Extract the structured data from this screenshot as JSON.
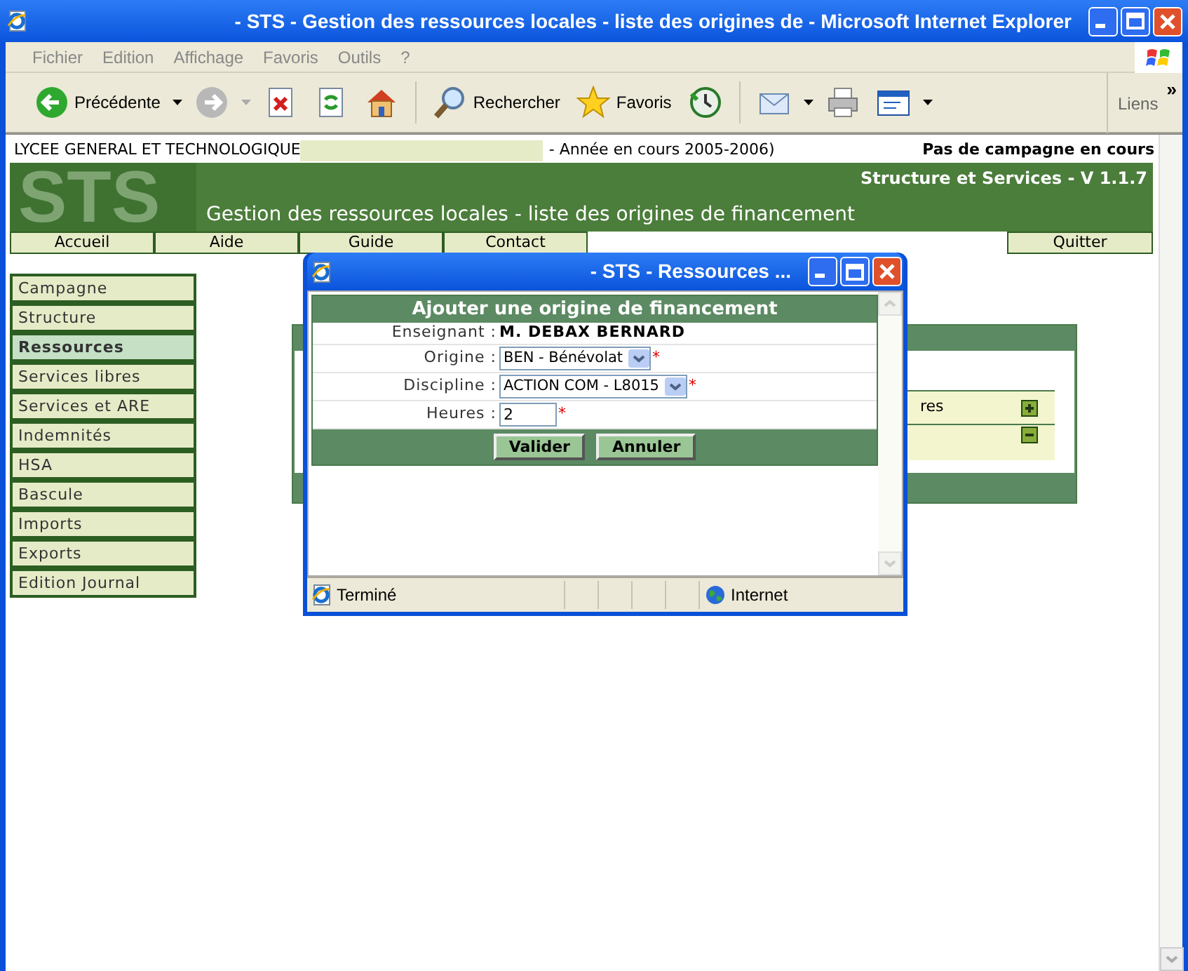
{
  "window": {
    "title": "- STS - Gestion des ressources locales - liste des origines de - Microsoft Internet Explorer"
  },
  "menu": [
    "Fichier",
    "Edition",
    "Affichage",
    "Favoris",
    "Outils",
    "?"
  ],
  "toolbar": [
    {
      "kind": "back",
      "label": "Précédente",
      "dropdown": true
    },
    {
      "kind": "forward",
      "dropdown": true
    },
    {
      "kind": "stop"
    },
    {
      "kind": "refresh"
    },
    {
      "kind": "home"
    },
    {
      "kind": "separator"
    },
    {
      "kind": "search",
      "label": "Rechercher"
    },
    {
      "kind": "favorites",
      "label": "Favoris"
    },
    {
      "kind": "history"
    },
    {
      "kind": "separator"
    },
    {
      "kind": "mail",
      "dropdown": true
    },
    {
      "kind": "print"
    },
    {
      "kind": "edit",
      "dropdown": true
    }
  ],
  "links": {
    "label": "Liens",
    "chevron": "»"
  },
  "page": {
    "school": "LYCEE GENERAL ET TECHNOLOGIQUE",
    "year": "- Année en cours 2005-2006)",
    "campaign": "Pas de campagne en cours",
    "logo": "STS",
    "version": "Structure et Services - V 1.1.7",
    "heading": "Gestion des ressources locales - liste des origines de financement",
    "nav": [
      "Accueil",
      "Aide",
      "Guide",
      "Contact"
    ],
    "quit": "Quitter",
    "sidebar": [
      {
        "label": "Campagne",
        "selected": false
      },
      {
        "label": "Structure",
        "selected": false
      },
      {
        "label": "Ressources",
        "selected": true
      },
      {
        "label": "Services libres",
        "selected": false
      },
      {
        "label": "Services et ARE",
        "selected": false
      },
      {
        "label": "Indemnités",
        "selected": false
      },
      {
        "label": "HSA",
        "selected": false
      },
      {
        "label": "Bascule",
        "selected": false
      },
      {
        "label": "Imports",
        "selected": false
      },
      {
        "label": "Exports",
        "selected": false
      },
      {
        "label": "Edition Journal",
        "selected": false
      }
    ],
    "panel": {
      "row_text": "res"
    }
  },
  "popup": {
    "title": "- STS - Ressources ...",
    "form_title": "Ajouter une origine de financement",
    "fields": [
      {
        "kind": "text",
        "label": "Enseignant :",
        "value": "M. DEBAX BERNARD"
      },
      {
        "kind": "select",
        "label": "Origine :",
        "value": "BEN - Bénévolat",
        "required_mark": "*"
      },
      {
        "kind": "select",
        "label": "Discipline :",
        "value": "ACTION COM - L8015",
        "required_mark": "*"
      },
      {
        "kind": "input",
        "label": "Heures :",
        "value": "2",
        "required_mark": "*"
      }
    ],
    "buttons": [
      "Valider",
      "Annuler"
    ],
    "status": "Terminé",
    "zone": "Internet"
  }
}
